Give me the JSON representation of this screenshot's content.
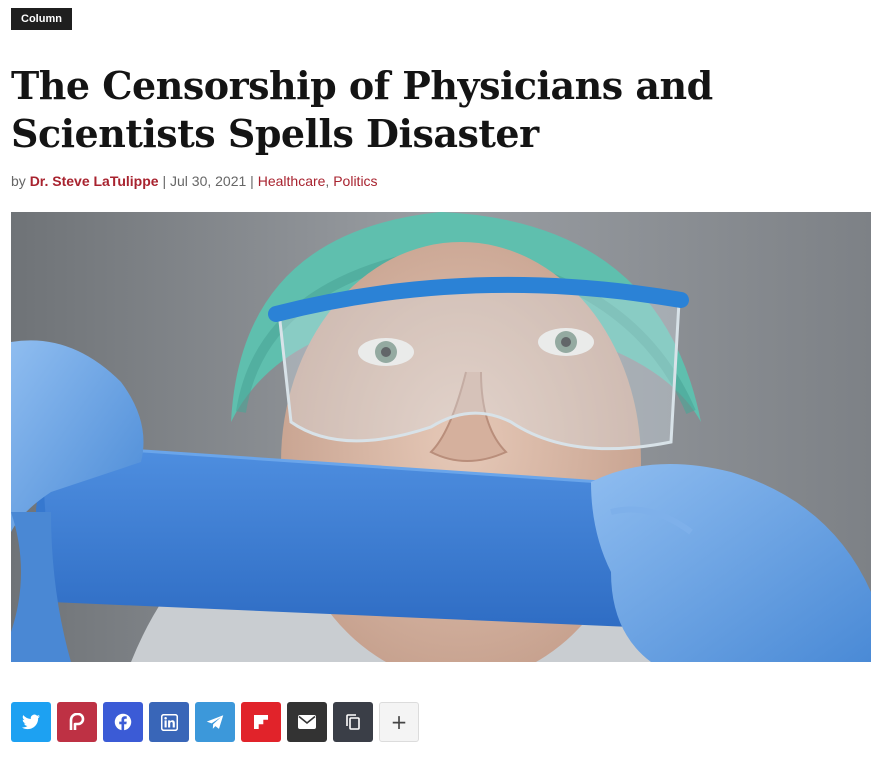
{
  "category_tag": "Column",
  "article": {
    "title": "The Censorship of Physicians and Scientists Spells Disaster",
    "meta": {
      "by_prefix": "by ",
      "author": "Dr. Steve LaTulippe",
      "sep1": " | ",
      "date": "Jul 30, 2021",
      "sep2": " | ",
      "category_1": "Healthcare",
      "category_comma": ", ",
      "category_2": "Politics"
    }
  },
  "share_buttons": [
    {
      "icon": "twitter-icon",
      "color": "#1da1f2"
    },
    {
      "icon": "parler-icon",
      "color": "#be3144"
    },
    {
      "icon": "facebook-icon",
      "color": "#3b5bd6"
    },
    {
      "icon": "linkedin-icon",
      "color": "#3966b8"
    },
    {
      "icon": "telegram-icon",
      "color": "#3c98da"
    },
    {
      "icon": "flipboard-icon",
      "color": "#e1232a"
    },
    {
      "icon": "email-icon",
      "color": "#333333"
    },
    {
      "icon": "copy-link-icon",
      "color": "#3a3e47"
    },
    {
      "icon": "more-share-icon",
      "label": "+"
    }
  ]
}
